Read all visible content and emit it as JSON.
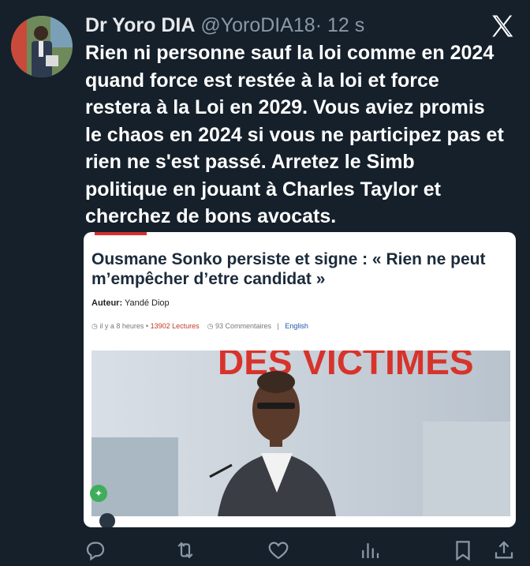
{
  "tweet": {
    "author_name": "Dr Yoro DIA",
    "handle": "@YoroDIA18",
    "separator": "·",
    "time": "12 s",
    "text": "Rien ni personne sauf la loi comme en 2024\nquand force est restée  à la loi et force\nrestera à la Loi en 2029. Vous aviez promis\nle chaos en 2024 si vous ne participez pas et\nrien ne s'est passé. Arretez le Simb\npolitique en jouant à Charles Taylor  et\ncherchez de bons avocats."
  },
  "card": {
    "headline": "Ousmane Sonko persiste et signe : « Rien ne peut m’empêcher d’etre candidat »",
    "author_label": "Auteur:",
    "author_name": "Yandé Diop",
    "time_ago": "il y a 8 heures",
    "reads": "13902 Lectures",
    "comments": "93 Commentaires",
    "separator": "|",
    "language": "English",
    "photo_banner_text": "DES VICTIMES"
  },
  "icons": {
    "reply": "reply-icon",
    "retweet": "retweet-icon",
    "like": "heart-icon",
    "views": "views-chart-icon",
    "bookmark": "bookmark-icon",
    "share": "share-icon",
    "logo": "x-logo-icon"
  },
  "colors": {
    "background": "#15202b",
    "text": "#ffffff",
    "handle": "#8b98a5",
    "card_accent": "#d9302b",
    "headline": "#1c2b3a"
  }
}
